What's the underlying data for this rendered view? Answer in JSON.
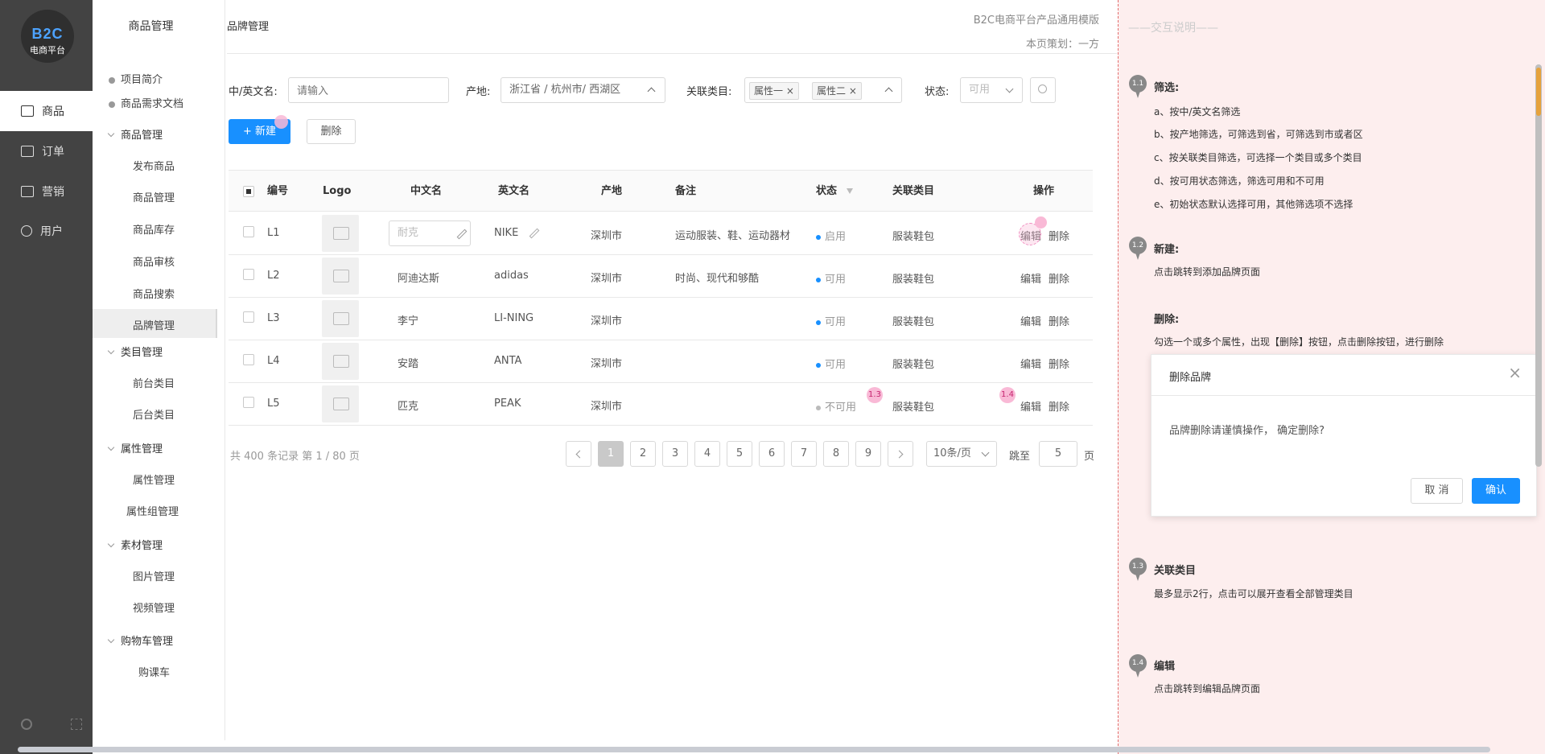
{
  "app": {
    "logo_text": "B2C",
    "logo_sub": "电商平台",
    "nav": [
      {
        "label": "商品",
        "active": true,
        "icon": "box-icon"
      },
      {
        "label": "订单",
        "active": false,
        "icon": "order-icon"
      },
      {
        "label": "营销",
        "active": false,
        "icon": "marketing-icon"
      },
      {
        "label": "用户",
        "active": false,
        "icon": "user-icon"
      }
    ]
  },
  "sidebar": {
    "title": "商品管理",
    "top_links": [
      "项目简介",
      "商品需求文档"
    ],
    "groups": [
      {
        "label": "商品管理",
        "items": [
          "发布商品",
          "商品管理",
          "商品库存",
          "商品审核",
          "商品搜索",
          "品牌管理"
        ]
      },
      {
        "label": "类目管理",
        "items": [
          "前台类目",
          "后台类目"
        ]
      },
      {
        "label": "属性管理",
        "items": [
          "属性管理",
          "属性组管理"
        ]
      },
      {
        "label": "素材管理",
        "items": [
          "图片管理",
          "视频管理"
        ]
      },
      {
        "label": "购物车管理",
        "items": [
          "购课车"
        ]
      }
    ],
    "active_item": "品牌管理"
  },
  "header": {
    "breadcrumb": "品牌管理",
    "template_name": "B2C电商平台产品通用模版",
    "planner": "本页策划：一方"
  },
  "filters": {
    "name_label": "中/英文名:",
    "name_placeholder": "请输入",
    "origin_label": "产地:",
    "origin_value": "浙江省 / 杭州市/ 西湖区",
    "category_label": "关联类目:",
    "category_tags": [
      "属性一",
      "属性二"
    ],
    "status_label": "状态:",
    "status_value": "可用"
  },
  "actions": {
    "new_label": "+ 新建",
    "delete_label": "删除"
  },
  "table": {
    "columns": [
      "编号",
      "Logo",
      "中文名",
      "英文名",
      "产地",
      "备注",
      "状态",
      "关联类目",
      "操作"
    ],
    "rows": [
      {
        "id": "L1",
        "cn": "",
        "cn_placeholder": "耐克",
        "en": "NIKE",
        "origin": "深圳市",
        "note": "运动服装、鞋、运动器材",
        "status": "启用",
        "status_color": "#1890ff",
        "category": "服装鞋包",
        "edit": "编辑",
        "del": "删除"
      },
      {
        "id": "L2",
        "cn": "阿迪达斯",
        "en": "adidas",
        "origin": "深圳市",
        "note": "时尚、现代和够酷",
        "status": "可用",
        "status_color": "#1890ff",
        "category": "服装鞋包",
        "edit": "编辑",
        "del": "删除"
      },
      {
        "id": "L3",
        "cn": "李宁",
        "en": "LI-NING",
        "origin": "深圳市",
        "note": "",
        "status": "可用",
        "status_color": "#1890ff",
        "category": "服装鞋包",
        "edit": "编辑",
        "del": "删除"
      },
      {
        "id": "L4",
        "cn": "安踏",
        "en": "ANTA",
        "origin": "深圳市",
        "note": "",
        "status": "可用",
        "status_color": "#1890ff",
        "category": "服装鞋包",
        "edit": "编辑",
        "del": "删除"
      },
      {
        "id": "L5",
        "cn": "匹克",
        "en": "PEAK",
        "origin": "深圳市",
        "note": "",
        "status": "不可用",
        "status_color": "#bbbbbb",
        "category": "服装鞋包",
        "edit": "编辑",
        "del": "删除"
      }
    ]
  },
  "pagination": {
    "summary": "共 400 条记录 第 1 / 80 页",
    "pages": [
      "1",
      "2",
      "3",
      "4",
      "5",
      "6",
      "7",
      "8",
      "9"
    ],
    "current": "1",
    "page_size": "10条/页",
    "jump_label": "跳至",
    "jump_value": "5",
    "page_suffix": "页"
  },
  "pins": {
    "p13": "1.3",
    "p14": "1.4"
  },
  "notes": {
    "header": "——交互说明——",
    "items": [
      {
        "pin": "1.1",
        "title": "筛选:",
        "lines": [
          "a、按中/英文名筛选",
          "b、按产地筛选，可筛选到省，可筛选到市或者区",
          "c、按关联类目筛选，可选择一个类目或多个类目",
          "d、按可用状态筛选，筛选可用和不可用",
          "e、初始状态默认选择可用，其他筛选项不选择"
        ]
      },
      {
        "pin": "1.2",
        "title": "新建:",
        "lines": [
          "点击跳转到添加品牌页面"
        ]
      },
      {
        "pin": "",
        "title": "删除:",
        "lines": [
          "勾选一个或多个属性，出现【删除】按钮，点击删除按钮，进行删除"
        ]
      },
      {
        "pin": "1.3",
        "title": "关联类目",
        "lines": [
          "最多显示2行，点击可以展开查看全部管理类目"
        ]
      },
      {
        "pin": "1.4",
        "title": "编辑",
        "lines": [
          "点击跳转到编辑品牌页面"
        ]
      }
    ]
  },
  "modal": {
    "title": "删除品牌",
    "body": "品牌删除请谨慎操作， 确定删除?",
    "cancel": "取 消",
    "confirm": "确认"
  }
}
